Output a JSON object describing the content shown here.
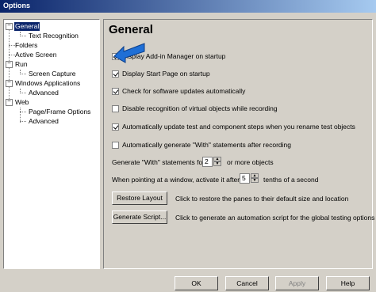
{
  "window": {
    "title": "Options"
  },
  "tree": {
    "items": [
      {
        "label": "General",
        "selected": true
      },
      {
        "label": "Text Recognition"
      },
      {
        "label": "Folders"
      },
      {
        "label": "Active Screen"
      },
      {
        "label": "Run"
      },
      {
        "label": "Screen Capture"
      },
      {
        "label": "Windows Applications"
      },
      {
        "label": "Advanced"
      },
      {
        "label": "Web"
      },
      {
        "label": "Page/Frame Options"
      },
      {
        "label": "Advanced"
      }
    ]
  },
  "general": {
    "heading": "General",
    "options": [
      {
        "label": "Display Add-in Manager on startup",
        "checked": true
      },
      {
        "label": "Display Start Page on startup",
        "checked": true
      },
      {
        "label": "Check for software updates automatically",
        "checked": true
      },
      {
        "label": "Disable recognition of virtual objects while recording",
        "checked": false
      },
      {
        "label": "Automatically update test and component steps when you rename test objects",
        "checked": true
      },
      {
        "label": "Automatically generate \"With\" statements after recording",
        "checked": false
      }
    ],
    "with_stmt": {
      "prefix": "Generate \"With\" statements for",
      "value": "2",
      "suffix": "or more objects"
    },
    "activate": {
      "prefix": "When pointing at a window, activate it after",
      "value": "5",
      "suffix": "tenths of a second"
    },
    "restore_layout": {
      "button": "Restore Layout",
      "description": "Click to restore the panes to their default size and location"
    },
    "generate_script": {
      "button": "Generate Script...",
      "description": "Click to generate an automation script for the global testing options"
    }
  },
  "footer": {
    "ok": "OK",
    "cancel": "Cancel",
    "apply": "Apply",
    "help": "Help"
  },
  "colors": {
    "arrow": "#1f6fd6",
    "selection": "#0a246a"
  }
}
